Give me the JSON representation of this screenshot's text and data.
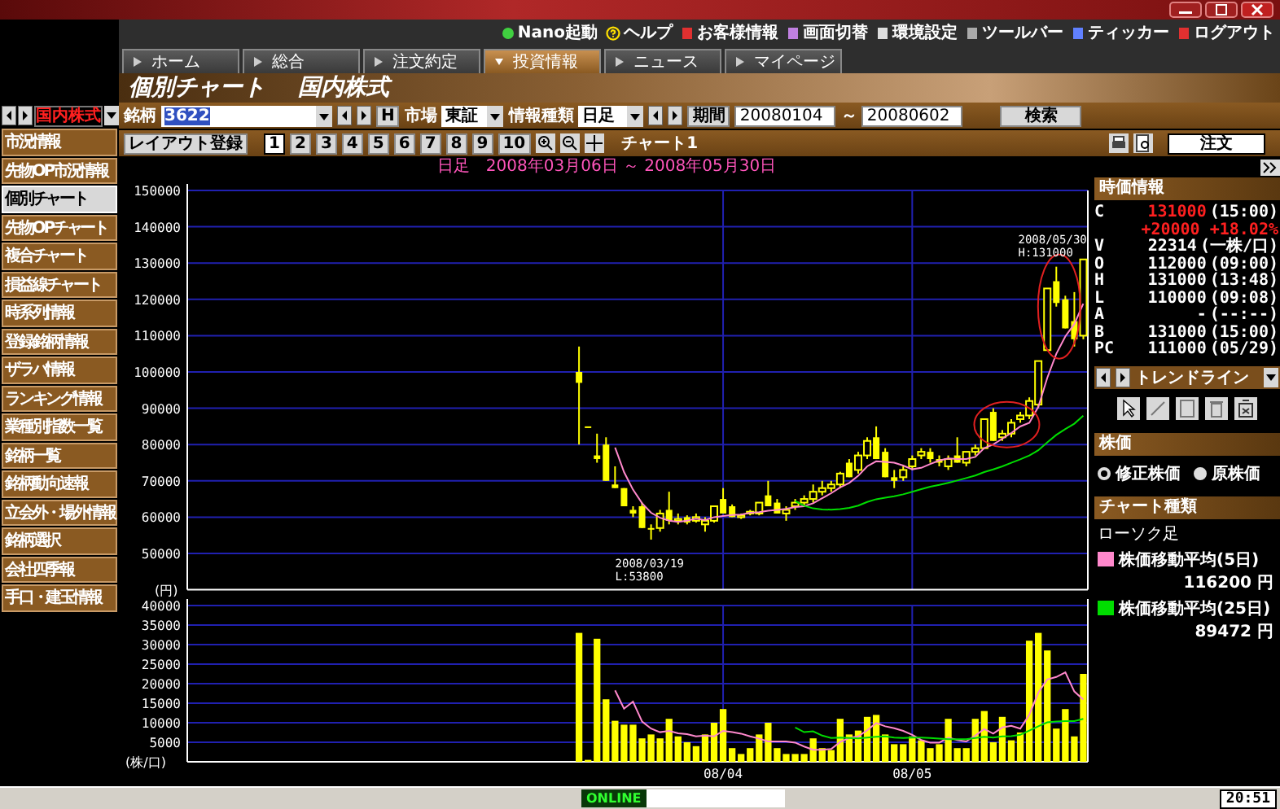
{
  "top_links": [
    {
      "label": "Nano起動",
      "kind": "nano"
    },
    {
      "label": "ヘルプ",
      "kind": "help"
    },
    {
      "label": "お客様情報",
      "kind": "customer"
    },
    {
      "label": "画面切替",
      "kind": "screen"
    },
    {
      "label": "環境設定",
      "kind": "settings"
    },
    {
      "label": "ツールバー",
      "kind": "toolbar"
    },
    {
      "label": "ティッカー",
      "kind": "ticker"
    },
    {
      "label": "ログアウト",
      "kind": "logout"
    }
  ],
  "tabs": [
    {
      "label": "ホーム",
      "selected": false
    },
    {
      "label": "総合",
      "selected": false
    },
    {
      "label": "注文約定",
      "selected": false
    },
    {
      "label": "投資情報",
      "selected": true
    },
    {
      "label": "ニュース",
      "selected": false
    },
    {
      "label": "マイページ",
      "selected": false
    }
  ],
  "page_title": [
    "個別チャート",
    "国内株式"
  ],
  "sidebar": {
    "market": "国内株式",
    "items": [
      {
        "label": "市況情報",
        "selected": false
      },
      {
        "label": "先物OP市況情報",
        "selected": false
      },
      {
        "label": "個別チャート",
        "selected": true
      },
      {
        "label": "先物OPチャート",
        "selected": false
      },
      {
        "label": "複合チャート",
        "selected": false
      },
      {
        "label": "損益線チャート",
        "selected": false
      },
      {
        "label": "時系列情報",
        "selected": false
      },
      {
        "label": "登録銘柄情報",
        "selected": false
      },
      {
        "label": "ザラバ情報",
        "selected": false
      },
      {
        "label": "ランキング情報",
        "selected": false
      },
      {
        "label": "業種別指数一覧",
        "selected": false
      },
      {
        "label": "銘柄一覧",
        "selected": false
      },
      {
        "label": "銘柄動向速報",
        "selected": false
      },
      {
        "label": "立会外・場外情報",
        "selected": false
      },
      {
        "label": "銘柄選択",
        "selected": false
      },
      {
        "label": "会社四季報",
        "selected": false
      },
      {
        "label": "手口・建玉情報",
        "selected": false
      }
    ]
  },
  "search_form": {
    "symbol_label": "銘柄",
    "symbol": "3622",
    "h_button": "H",
    "market_label": "市場",
    "market": "東証",
    "info_label": "情報種類",
    "info": "日足",
    "period_button": "期間",
    "date_from": "20080104",
    "date_separator": "～",
    "date_to": "20080602",
    "search_button": "検索"
  },
  "toolbar": {
    "layout_button": "レイアウト登録",
    "pages": [
      {
        "label": "1",
        "selected": true
      },
      {
        "label": "2",
        "selected": false
      },
      {
        "label": "3",
        "selected": false
      },
      {
        "label": "4",
        "selected": false
      },
      {
        "label": "5",
        "selected": false
      },
      {
        "label": "6",
        "selected": false
      },
      {
        "label": "7",
        "selected": false
      },
      {
        "label": "8",
        "selected": false
      },
      {
        "label": "9",
        "selected": false
      },
      {
        "label": "10",
        "selected": false
      }
    ],
    "chart_name": "チャート1",
    "order_button": "注文"
  },
  "price_chart": {
    "title": "日足　2008年03月06日 ～ 2008年05月30日",
    "y_labels": [
      "150000",
      "140000",
      "130000",
      "120000",
      "110000",
      "100000",
      "90000",
      "80000",
      "70000",
      "60000",
      "50000"
    ],
    "unit": "(円)",
    "low_note": [
      "2008/03/19",
      "L:53800"
    ],
    "high_note": [
      "2008/05/30",
      "H:131000"
    ]
  },
  "volume_chart": {
    "chart_data": {
      "type": "bar",
      "grid": true,
      "ylabel": "(株/口)",
      "ylim": [
        0,
        40000
      ],
      "yticks": [
        5000,
        10000,
        15000,
        20000,
        25000,
        30000,
        35000,
        40000
      ],
      "categories": [
        null,
        null,
        null,
        null,
        null,
        null,
        null,
        null,
        null,
        null,
        null,
        null,
        null,
        null,
        null,
        null,
        null,
        null,
        null,
        null,
        null,
        null,
        null,
        null,
        null,
        null,
        null,
        null,
        null,
        null,
        null,
        null,
        null,
        null,
        null,
        null,
        null,
        null,
        null,
        null,
        null,
        null,
        null,
        null,
        null,
        null,
        null,
        null,
        null,
        null,
        null,
        null,
        null,
        null,
        null,
        null,
        null,
        null,
        null,
        "08/04",
        null,
        null,
        null,
        null,
        null,
        null,
        null,
        null,
        null,
        null,
        null,
        null,
        null,
        null,
        null,
        null,
        null,
        null,
        null,
        null,
        "08/05",
        null,
        null,
        null,
        null,
        null,
        null,
        null,
        null,
        null,
        null,
        null,
        null,
        null,
        null,
        null,
        null,
        null,
        null,
        null
      ],
      "stacked": false,
      "series": [
        {
          "type": "bar",
          "color": "#ffff00",
          "values": [
            null,
            null,
            null,
            null,
            null,
            null,
            null,
            null,
            null,
            null,
            null,
            null,
            null,
            null,
            null,
            null,
            null,
            null,
            null,
            null,
            null,
            null,
            null,
            null,
            null,
            null,
            null,
            null,
            null,
            null,
            null,
            null,
            null,
            null,
            null,
            null,
            null,
            null,
            null,
            null,
            null,
            null,
            null,
            33000,
            500,
            31500,
            16000,
            10500,
            9500,
            9500,
            6000,
            7000,
            6000,
            11000,
            6500,
            5000,
            4000,
            7000,
            10000,
            13500,
            3500,
            2000,
            3500,
            7000,
            10000,
            3500,
            2000,
            2000,
            2000,
            6000,
            3500,
            3000,
            11000,
            7000,
            8000,
            11500,
            12000,
            7000,
            4500,
            4500,
            6500,
            5500,
            3500,
            4500,
            11000,
            3500,
            3500,
            11000,
            13000,
            5000,
            11500,
            5500,
            7500,
            31000,
            33000,
            28500,
            8500,
            13500,
            6500,
            22500
          ]
        },
        {
          "type": "line",
          "color": "#ff88cc",
          "values": [
            null,
            null,
            null,
            null,
            null,
            null,
            null,
            null,
            null,
            null,
            null,
            null,
            null,
            null,
            null,
            null,
            null,
            null,
            null,
            null,
            null,
            null,
            null,
            null,
            null,
            null,
            null,
            null,
            null,
            null,
            null,
            null,
            null,
            null,
            null,
            null,
            null,
            null,
            null,
            null,
            null,
            null,
            null,
            null,
            null,
            null,
            null,
            18300,
            13600,
            15400,
            10300,
            8500,
            7600,
            7900,
            7300,
            7100,
            6500,
            6700,
            6500,
            7900,
            7600,
            7200,
            6500,
            5900,
            5200,
            5200,
            5200,
            4900,
            3900,
            3100,
            3100,
            3300,
            5100,
            6100,
            6500,
            8100,
            9900,
            9100,
            8600,
            7900,
            6900,
            5600,
            4900,
            4900,
            6200,
            5600,
            5200,
            6700,
            8400,
            7200,
            8800,
            9200,
            8500,
            12100,
            17700,
            21100,
            21700,
            22900,
            18000,
            15900
          ]
        },
        {
          "type": "line",
          "color": "#00dd00",
          "values": [
            null,
            null,
            null,
            null,
            null,
            null,
            null,
            null,
            null,
            null,
            null,
            null,
            null,
            null,
            null,
            null,
            null,
            null,
            null,
            null,
            null,
            null,
            null,
            null,
            null,
            null,
            null,
            null,
            null,
            null,
            null,
            null,
            null,
            null,
            null,
            null,
            null,
            null,
            null,
            null,
            null,
            null,
            null,
            null,
            null,
            null,
            null,
            null,
            null,
            null,
            null,
            null,
            null,
            null,
            null,
            null,
            null,
            null,
            null,
            null,
            null,
            null,
            null,
            null,
            null,
            null,
            null,
            8800,
            7600,
            7800,
            6700,
            6100,
            6200,
            6100,
            6000,
            6200,
            6400,
            6500,
            6200,
            6100,
            6200,
            6200,
            6100,
            5900,
            5800,
            5800,
            5800,
            6100,
            6400,
            6200,
            6500,
            6600,
            6900,
            8000,
            9100,
            10100,
            10300,
            10400,
            10400,
            11000
          ]
        }
      ]
    }
  },
  "quote": {
    "title": "時価情報",
    "rows": [
      {
        "label": "C",
        "value": "131000",
        "time": "(15:00)",
        "emphasis": true,
        "change": "+20000 +18.02%"
      },
      {
        "label": "V",
        "value": "22314",
        "time": "(一株/口)",
        "emphasis": false
      },
      {
        "label": "O",
        "value": "112000",
        "time": "(09:00)",
        "emphasis": false
      },
      {
        "label": "H",
        "value": "131000",
        "time": "(13:48)",
        "emphasis": false
      },
      {
        "label": "L",
        "value": "110000",
        "time": "(09:08)",
        "emphasis": false
      },
      {
        "label": "A",
        "value": "-",
        "time": "(--:--)",
        "emphasis": false
      },
      {
        "label": "B",
        "value": "131000",
        "time": "(15:00)",
        "emphasis": false
      },
      {
        "label": "PC",
        "value": "111000",
        "time": "(05/29)",
        "emphasis": false
      }
    ]
  },
  "trendline": {
    "label": "トレンドライン"
  },
  "price_basis": {
    "title": "株価",
    "options": [
      {
        "label": "修正株価",
        "selected": true
      },
      {
        "label": "原株価",
        "selected": false
      }
    ]
  },
  "chart_type": {
    "title": "チャート種類",
    "name": "ローソク足",
    "legend": [
      {
        "label": "株価移動平均(5日)",
        "value": "116200 円",
        "color": "#ff88cc"
      },
      {
        "label": "株価移動平均(25日)",
        "value": "89472 円",
        "color": "#00dd00"
      }
    ]
  },
  "status_bar": {
    "connection": "ONLINE",
    "time": "20:51"
  }
}
